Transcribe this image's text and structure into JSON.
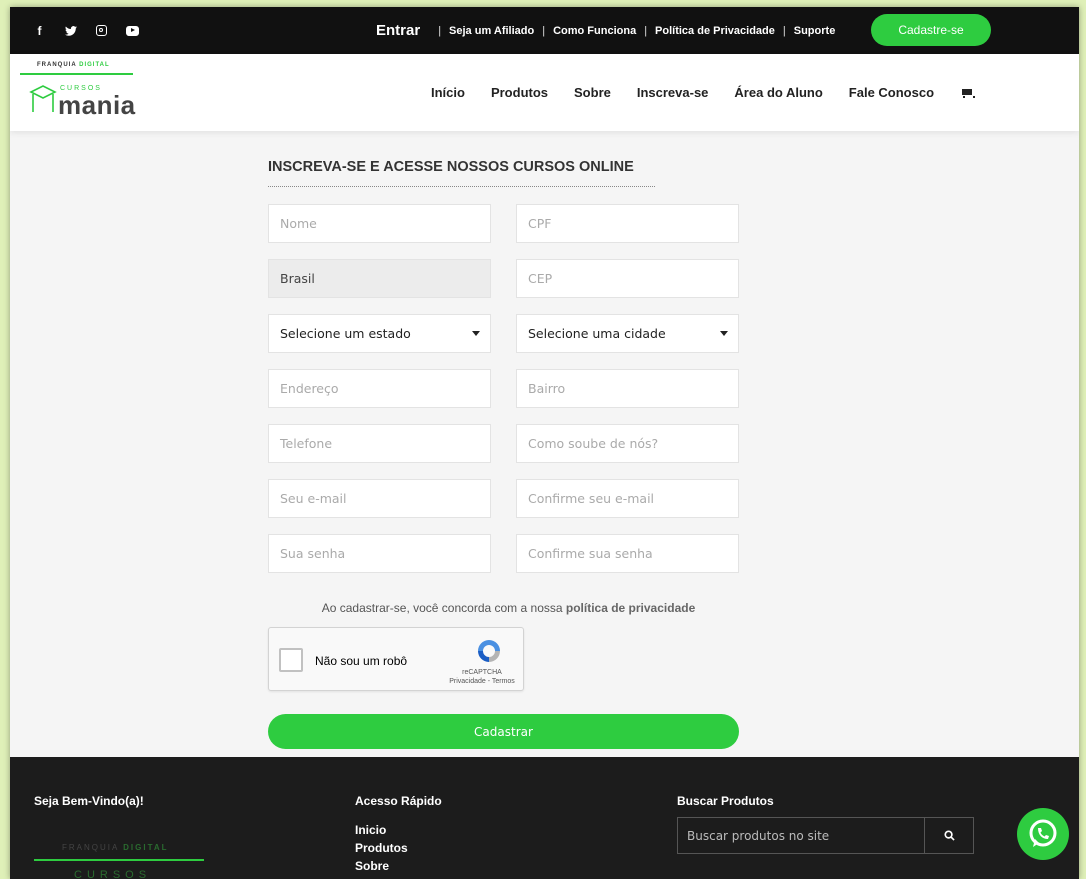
{
  "topbar": {
    "social_icons": [
      "facebook-icon",
      "twitter-icon",
      "instagram-icon",
      "youtube-icon"
    ],
    "entrar": "Entrar",
    "links": [
      "Seja um Afiliado",
      "Como Funciona",
      "Política de Privacidade",
      "Suporte"
    ],
    "separator": "|",
    "cta": "Cadastre-se"
  },
  "logo": {
    "tag_prefix": "FRANQUIA ",
    "tag_suffix": "DIGITAL",
    "cursos": "CURSOS",
    "mania": "mania"
  },
  "nav": {
    "items": [
      "Início",
      "Produtos",
      "Sobre",
      "Inscreva-se",
      "Área do Aluno",
      "Fale Conosco"
    ]
  },
  "form": {
    "title": "INSCREVA-SE E ACESSE NOSSOS CURSOS ONLINE",
    "nome_placeholder": "Nome",
    "cpf_placeholder": "CPF",
    "pais_value": "Brasil",
    "cep_placeholder": "CEP",
    "estado_selected": "Selecione um estado",
    "cidade_selected": "Selecione uma cidade",
    "endereco_placeholder": "Endereço",
    "bairro_placeholder": "Bairro",
    "telefone_placeholder": "Telefone",
    "como_soube_placeholder": "Como soube de nós?",
    "email_placeholder": "Seu e-mail",
    "confirm_email_placeholder": "Confirme seu e-mail",
    "senha_placeholder": "Sua senha",
    "confirm_senha_placeholder": "Confirme sua senha",
    "agree_text": "Ao cadastrar-se, você concorda com a nossa ",
    "agree_link": "política de privacidade",
    "submit": "Cadastrar"
  },
  "recaptcha": {
    "label": "Não sou um robô",
    "brand": "reCAPTCHA",
    "terms": "Privacidade - Termos"
  },
  "footer": {
    "welcome": "Seja Bem-Vindo(a)!",
    "quick_access_title": "Acesso Rápido",
    "quick_links": [
      "Inicio",
      "Produtos",
      "Sobre"
    ],
    "search_title": "Buscar Produtos",
    "search_placeholder": "Buscar produtos no site",
    "logo_tag_prefix": "FRANQUIA ",
    "logo_tag_suffix": "DIGITAL",
    "logo_cursos": "CURSOS"
  },
  "colors": {
    "accent": "#2ecc40",
    "topbar": "#111111",
    "footer": "#1c1c1c"
  }
}
